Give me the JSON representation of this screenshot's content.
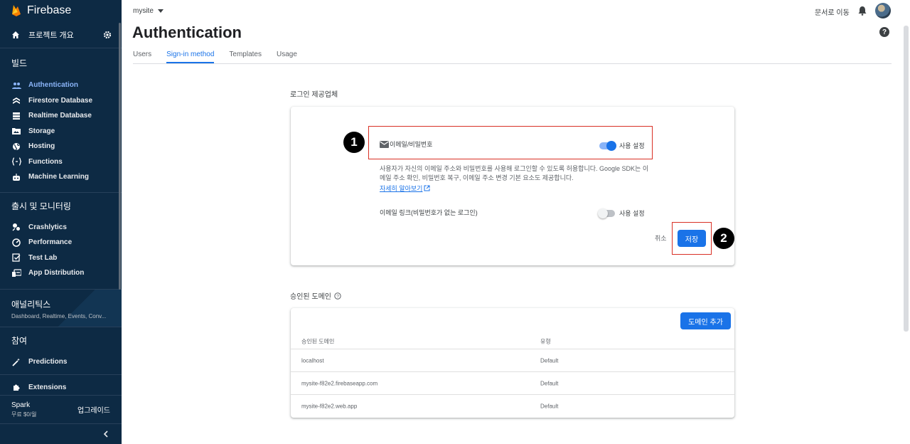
{
  "app": {
    "brand": "Firebase",
    "project": "mysite",
    "docs_link": "문서로 이동"
  },
  "sidebar": {
    "overview": "프로젝트 개요",
    "build_label": "빌드",
    "build_items": [
      {
        "label": "Authentication",
        "icon": "people-icon"
      },
      {
        "label": "Firestore Database",
        "icon": "firestore-icon"
      },
      {
        "label": "Realtime Database",
        "icon": "database-icon"
      },
      {
        "label": "Storage",
        "icon": "folder-icon"
      },
      {
        "label": "Hosting",
        "icon": "globe-icon"
      },
      {
        "label": "Functions",
        "icon": "functions-icon"
      },
      {
        "label": "Machine Learning",
        "icon": "robot-icon"
      }
    ],
    "release_label": "출시 및 모니터링",
    "release_items": [
      {
        "label": "Crashlytics",
        "icon": "crash-icon"
      },
      {
        "label": "Performance",
        "icon": "gauge-icon"
      },
      {
        "label": "Test Lab",
        "icon": "checklist-icon"
      },
      {
        "label": "App Distribution",
        "icon": "distribution-icon"
      }
    ],
    "analytics_title": "애널리틱스",
    "analytics_sub": "Dashboard, Realtime, Events, Conv...",
    "engage_label": "참여",
    "predictions": "Predictions",
    "extensions": "Extensions",
    "plan_name": "Spark",
    "plan_price": "무료 $0/월",
    "upgrade": "업그레이드"
  },
  "page": {
    "title": "Authentication",
    "tabs": [
      "Users",
      "Sign-in method",
      "Templates",
      "Usage"
    ],
    "active_tab": "Sign-in method"
  },
  "providers": {
    "section_title": "로그인 제공업체",
    "email_label": "이메일/비밀번호",
    "enable_label": "사용 설정",
    "email_enabled": true,
    "description": "사용자가 자신의 이메일 주소와 비밀번호를 사용해 로그인할 수 있도록 허용합니다. Google SDK는 이메일 주소 확인, 비밀번호 복구, 이메일 주소 변경 기본 요소도 제공합니다.",
    "learn_more": "자세히 알아보기",
    "link_label": "이메일 링크(비밀번호가 없는 로그인)",
    "link_enabled": false,
    "cancel": "취소",
    "save": "저장"
  },
  "annotations": {
    "badge1": "1",
    "badge2": "2",
    "color": "#d93025"
  },
  "domains": {
    "section_title": "승인된 도메인",
    "add_button": "도메인 추가",
    "columns": [
      "승인된 도메인",
      "유형"
    ],
    "rows": [
      [
        "localhost",
        "Default"
      ],
      [
        "mysite-f82e2.firebaseapp.com",
        "Default"
      ],
      [
        "mysite-f82e2.web.app",
        "Default"
      ]
    ]
  },
  "colors": {
    "sidebar_bg": "#0d2a44",
    "accent": "#1a73e8"
  }
}
